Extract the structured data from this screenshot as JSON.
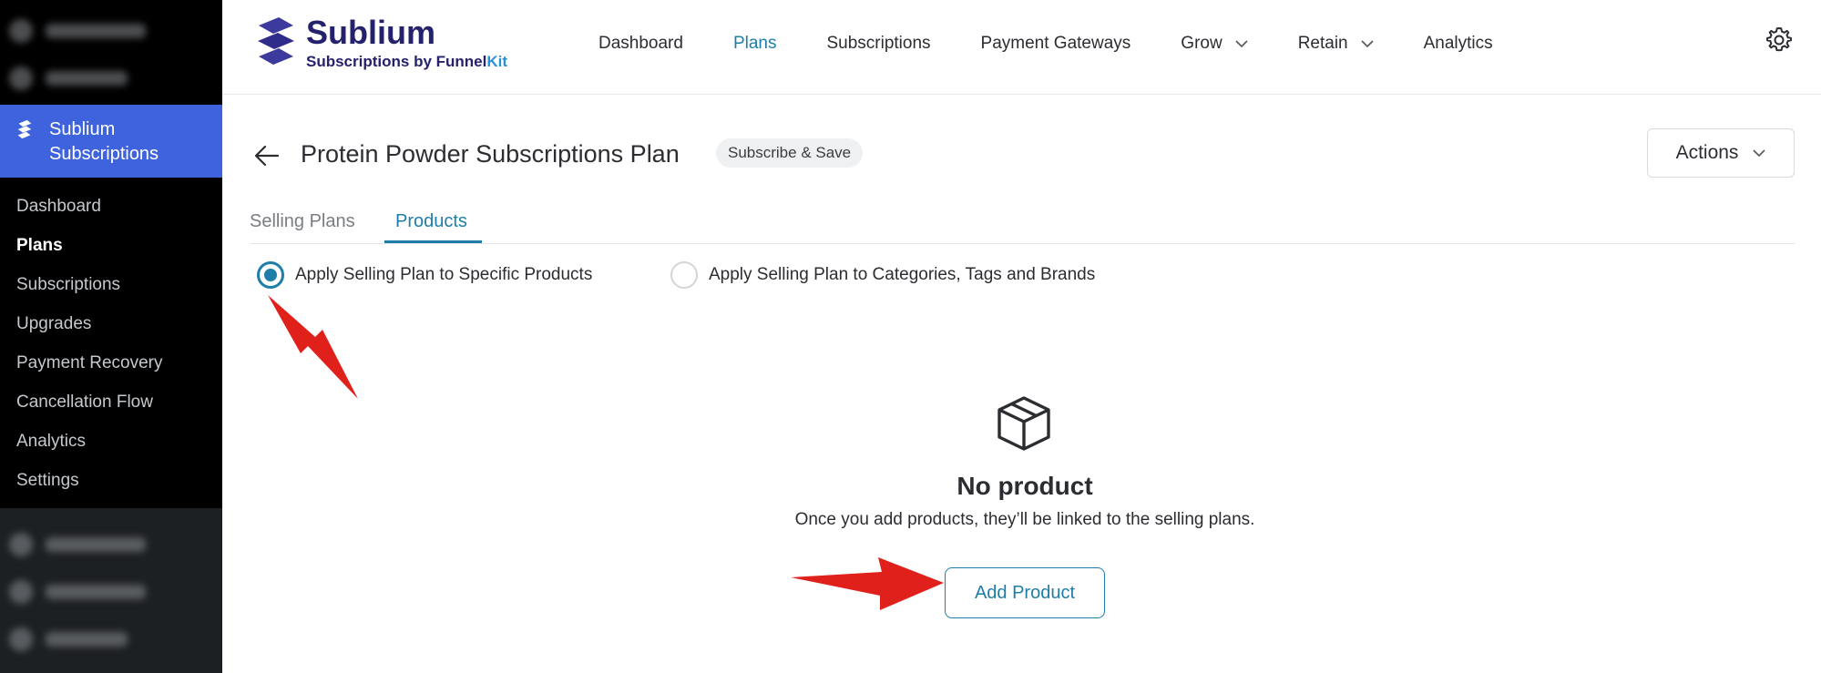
{
  "sidebar": {
    "plugin_name": "Sublium Subscriptions",
    "items": [
      {
        "label": "Dashboard"
      },
      {
        "label": "Plans"
      },
      {
        "label": "Subscriptions"
      },
      {
        "label": "Upgrades"
      },
      {
        "label": "Payment Recovery"
      },
      {
        "label": "Cancellation Flow"
      },
      {
        "label": "Analytics"
      },
      {
        "label": "Settings"
      }
    ],
    "active_item": "Plans"
  },
  "header": {
    "brand_name": "Sublium",
    "brand_tagline_prefix": "Subscriptions by Funnel",
    "brand_tagline_suffix": "Kit",
    "nav": [
      {
        "label": "Dashboard"
      },
      {
        "label": "Plans"
      },
      {
        "label": "Subscriptions"
      },
      {
        "label": "Payment Gateways"
      },
      {
        "label": "Grow"
      },
      {
        "label": "Retain"
      },
      {
        "label": "Analytics"
      }
    ],
    "active_nav": "Plans",
    "settings_icon": "gear-icon"
  },
  "page": {
    "title": "Protein Powder Subscriptions Plan",
    "badge": "Subscribe & Save",
    "actions_label": "Actions",
    "tabs": [
      {
        "label": "Selling Plans"
      },
      {
        "label": "Products"
      }
    ],
    "active_tab": "Products",
    "radio_options": [
      {
        "label": "Apply Selling Plan to Specific Products",
        "checked": true
      },
      {
        "label": "Apply Selling Plan to Categories, Tags and Brands",
        "checked": false
      }
    ],
    "empty_state": {
      "icon": "box-icon",
      "title": "No product",
      "description": "Once you add products, they’ll be linked to the selling plans.",
      "button_label": "Add Product"
    }
  },
  "colors": {
    "accent": "#1e7ea8",
    "brand_dark": "#24226d",
    "sidebar_active": "#3f63dd",
    "annotation_red": "#e0201b"
  }
}
